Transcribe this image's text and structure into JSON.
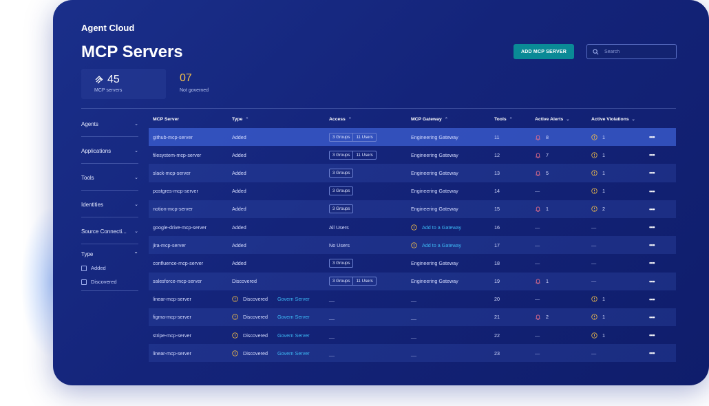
{
  "app_title": "Agent Cloud",
  "page_title": "MCP Servers",
  "add_button": "ADD MCP SERVER",
  "search_placeholder": "Search",
  "stats": [
    {
      "value": "45",
      "label": "MCP servers"
    },
    {
      "value": "07",
      "label": "Not governed"
    }
  ],
  "filters": [
    "Agents",
    "Applications",
    "Tools",
    "Identities",
    "Source Connecti..."
  ],
  "type_filter": {
    "label": "Type",
    "options": [
      "Added",
      "Discovered"
    ]
  },
  "columns": [
    "MCP Server",
    "Type",
    "Access",
    "MCP Gateway",
    "Tools",
    "Active Alerts",
    "Active Violations"
  ],
  "colors": {
    "accent_button": "#0a8a96",
    "link": "#3db9f5",
    "warning": "#f5c04a",
    "alert": "#f0708a"
  },
  "rows": [
    {
      "name": "github-mcp-server",
      "type": "Added",
      "groups": "3 Groups",
      "users": "11 Users",
      "gateway": "Engineering Gateway",
      "tools": "11",
      "alerts": "8",
      "violations": "1"
    },
    {
      "name": "filesystem-mcp-server",
      "type": "Added",
      "groups": "3 Groups",
      "users": "11 Users",
      "gateway": "Engineering Gateway",
      "tools": "12",
      "alerts": "7",
      "violations": "1"
    },
    {
      "name": "slack-mcp-server",
      "type": "Added",
      "groups": "3 Groups",
      "gateway": "Engineering Gateway",
      "tools": "13",
      "alerts": "5",
      "violations": "1"
    },
    {
      "name": "postgres-mcp-server",
      "type": "Added",
      "groups": "3 Groups",
      "gateway": "Engineering Gateway",
      "tools": "14",
      "alerts": "—",
      "violations": "1"
    },
    {
      "name": "notion-mcp-server",
      "type": "Added",
      "groups": "3 Groups",
      "gateway": "Engineering Gateway",
      "tools": "15",
      "alerts": "1",
      "violations": "2"
    },
    {
      "name": "google-drive-mcp-server",
      "type": "Added",
      "access_text": "All Users",
      "gateway_link": "Add to a Gateway",
      "tools": "16",
      "alerts": "—",
      "violations": "—"
    },
    {
      "name": "jira-mcp-server",
      "type": "Added",
      "access_text": "No Users",
      "gateway_link": "Add to a Gateway",
      "tools": "17",
      "alerts": "—",
      "violations": "—"
    },
    {
      "name": "confluence-mcp-server",
      "type": "Added",
      "groups": "3 Groups",
      "gateway": "Engineering Gateway",
      "tools": "18",
      "alerts": "—",
      "violations": "—"
    },
    {
      "name": "salesforce-mcp-server",
      "type": "Discovered",
      "groups": "3 Groups",
      "users": "11 Users",
      "gateway": "Engineering Gateway",
      "tools": "19",
      "alerts": "1",
      "violations": "—"
    },
    {
      "name": "linear-mcp-server",
      "type": "Discovered",
      "govern": "Govern Server",
      "access_text": "__",
      "gateway": "__",
      "tools": "20",
      "alerts": "—",
      "violations": "1"
    },
    {
      "name": "figma-mcp-server",
      "type": "Discovered",
      "govern": "Govern Server",
      "access_text": "__",
      "gateway": "__",
      "tools": "21",
      "alerts": "2",
      "violations": "1"
    },
    {
      "name": "stripe-mcp-server",
      "type": "Discovered",
      "govern": "Govern Server",
      "access_text": "__",
      "gateway": "__",
      "tools": "22",
      "alerts": "—",
      "violations": "1"
    },
    {
      "name": "linear-mcp-server",
      "type": "Discovered",
      "govern": "Govern Server",
      "access_text": "__",
      "gateway": "__",
      "tools": "23",
      "alerts": "—",
      "violations": "—"
    }
  ],
  "row_menu": "•••"
}
